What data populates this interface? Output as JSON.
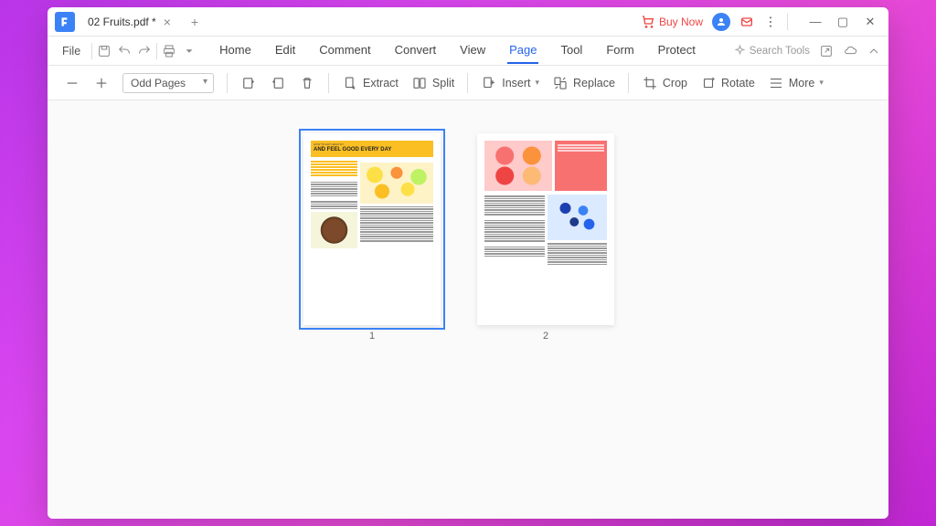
{
  "titlebar": {
    "filename": "02 Fruits.pdf *",
    "buy_now": "Buy Now"
  },
  "menubar": {
    "file": "File",
    "items": [
      "Home",
      "Edit",
      "Comment",
      "Convert",
      "View",
      "Page",
      "Tool",
      "Form",
      "Protect"
    ],
    "active_index": 5,
    "search_placeholder": "Search Tools"
  },
  "toolbar": {
    "filter_label": "Odd Pages",
    "extract": "Extract",
    "split": "Split",
    "insert": "Insert",
    "replace": "Replace",
    "crop": "Crop",
    "rotate": "Rotate",
    "more": "More"
  },
  "pages": [
    {
      "number": "1",
      "selected": true
    },
    {
      "number": "2",
      "selected": false
    }
  ],
  "page1_content": {
    "subtitle": "HOW TO EAT HEALTHY",
    "title": "AND FEEL GOOD EVERY DAY"
  }
}
